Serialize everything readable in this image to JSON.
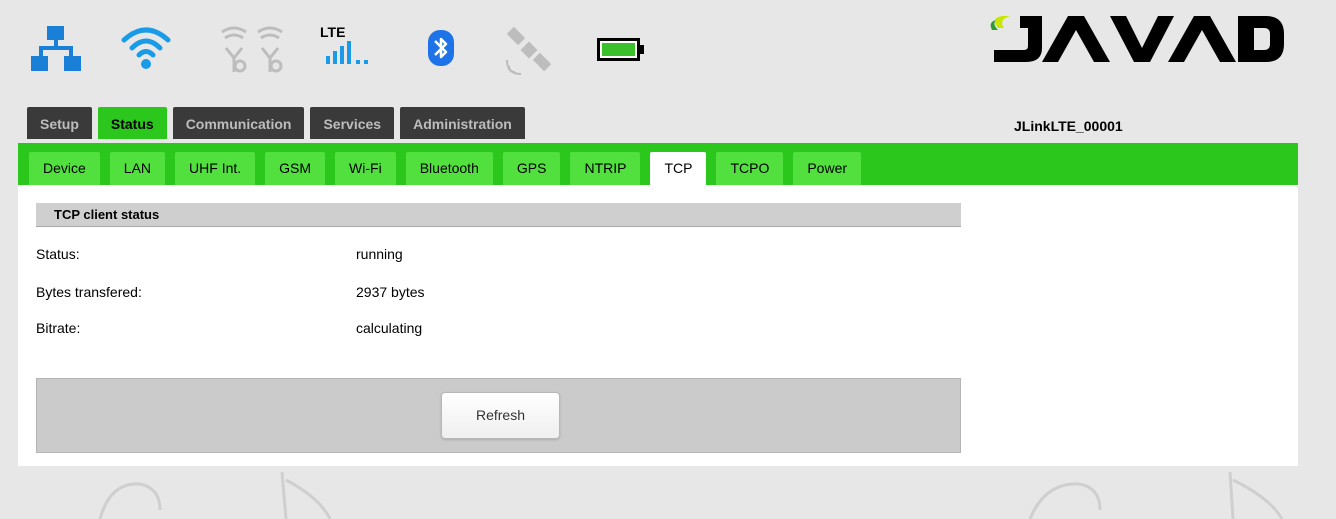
{
  "header": {
    "lte_label": "LTE",
    "device_name": "JLinkLTE_00001",
    "colors": {
      "wifi": "#1a9be8",
      "lan": "#1a7fd6",
      "bluetooth": "#1e73e8",
      "battery": "#39c02a",
      "accent": "#2bc71d"
    },
    "icons": [
      "lan-icon",
      "wifi-icon",
      "uhf-radio-icon",
      "lte-signal-icon",
      "bluetooth-icon",
      "satellite-icon",
      "battery-icon"
    ]
  },
  "main_tabs": [
    {
      "label": "Setup",
      "active": false
    },
    {
      "label": "Status",
      "active": true
    },
    {
      "label": "Communication",
      "active": false
    },
    {
      "label": "Services",
      "active": false
    },
    {
      "label": "Administration",
      "active": false
    }
  ],
  "sub_tabs": [
    {
      "label": "Device",
      "active": false
    },
    {
      "label": "LAN",
      "active": false
    },
    {
      "label": "UHF Int.",
      "active": false
    },
    {
      "label": "GSM",
      "active": false
    },
    {
      "label": "Wi-Fi",
      "active": false
    },
    {
      "label": "Bluetooth",
      "active": false
    },
    {
      "label": "GPS",
      "active": false
    },
    {
      "label": "NTRIP",
      "active": false
    },
    {
      "label": "TCP",
      "active": true
    },
    {
      "label": "TCPO",
      "active": false
    },
    {
      "label": "Power",
      "active": false
    }
  ],
  "section": {
    "title": "TCP client status",
    "rows": [
      {
        "label": "Status:",
        "value": "running"
      },
      {
        "label": "Bytes transfered:",
        "value": "2937 bytes"
      },
      {
        "label": "Bitrate:",
        "value": "calculating"
      }
    ],
    "refresh_label": "Refresh"
  }
}
